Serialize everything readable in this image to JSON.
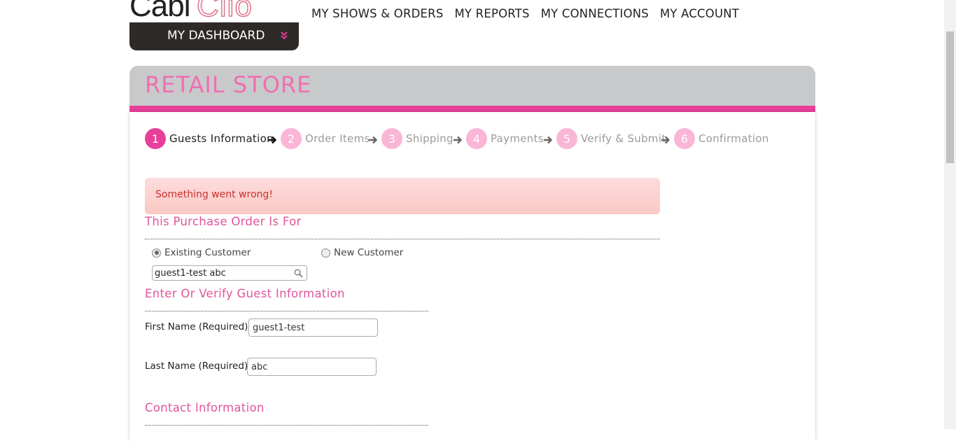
{
  "header": {
    "logo": {
      "dark": "Cabi",
      "pink": "Clio"
    },
    "dashboard_label": "MY DASHBOARD",
    "nav": [
      "MY SHOWS & ORDERS",
      "MY REPORTS",
      "MY CONNECTIONS",
      "MY ACCOUNT"
    ]
  },
  "panel": {
    "title": "RETAIL STORE"
  },
  "steps": [
    {
      "num": "1",
      "label": "Guests Information",
      "active": true
    },
    {
      "num": "2",
      "label": "Order Items",
      "active": false
    },
    {
      "num": "3",
      "label": "Shipping",
      "active": false
    },
    {
      "num": "4",
      "label": "Payments",
      "active": false
    },
    {
      "num": "5",
      "label": "Verify & Submit",
      "active": false
    },
    {
      "num": "6",
      "label": "Confirmation",
      "active": false
    }
  ],
  "alert": {
    "message": "Something went wrong!"
  },
  "purchase": {
    "title": "This Purchase Order Is For",
    "existing_label": "Existing Customer",
    "new_label": "New Customer",
    "search_value": "guest1-test abc"
  },
  "guest": {
    "title": "Enter Or Verify Guest Information",
    "first_label": "First Name (Required):",
    "first_value": "guest1-test",
    "last_label": "Last Name (Required):",
    "last_value": "abc"
  },
  "contact": {
    "title": "Contact Information"
  },
  "colors": {
    "accent": "#e8409a",
    "step_inactive": "#f9b6d6",
    "heading": "#f06eb0"
  }
}
